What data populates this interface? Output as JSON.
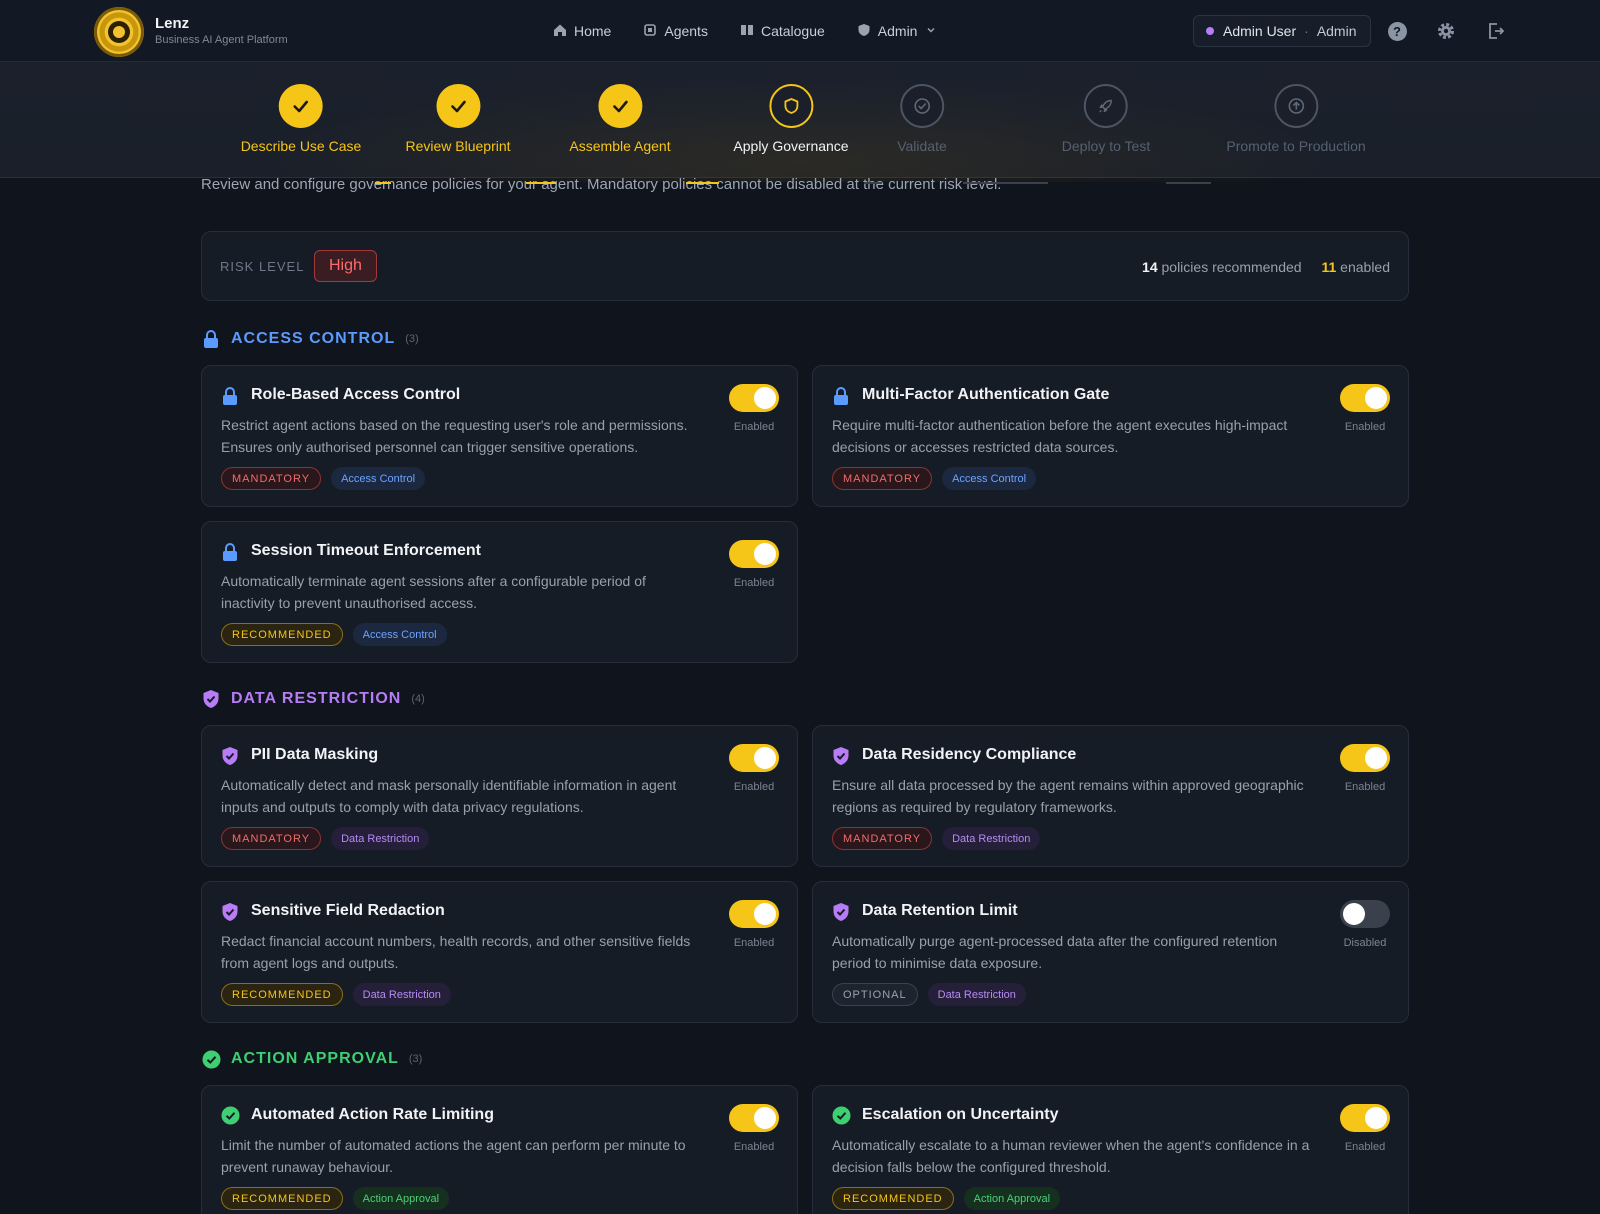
{
  "app": {
    "name": "Lenz",
    "tagline": "Business AI Agent Platform"
  },
  "nav": {
    "home": "Home",
    "agents": "Agents",
    "catalogue": "Catalogue",
    "admin": "Admin"
  },
  "user": {
    "name": "Admin User",
    "separator": "·",
    "role": "Admin"
  },
  "steps": [
    {
      "label": "Describe Use Case",
      "state": "done"
    },
    {
      "label": "Review Blueprint",
      "state": "done"
    },
    {
      "label": "Assemble Agent",
      "state": "done"
    },
    {
      "label": "Apply Governance",
      "state": "active"
    },
    {
      "label": "Validate",
      "state": "pending"
    },
    {
      "label": "Deploy to Test",
      "state": "pending"
    },
    {
      "label": "Promote to Production",
      "state": "pending"
    }
  ],
  "intro": "Review and configure governance policies for your agent. Mandatory policies cannot be disabled at the current risk level.",
  "risk": {
    "label": "RISK LEVEL",
    "level": "High",
    "recommended_count": "14",
    "recommended_text": "policies recommended",
    "enabled_count": "11",
    "enabled_text": "enabled"
  },
  "sections": {
    "access": {
      "title": "ACCESS CONTROL",
      "count": "(3)",
      "color": "#5b9bff"
    },
    "data": {
      "title": "DATA RESTRICTION",
      "count": "(4)",
      "color": "#b77cf6"
    },
    "action": {
      "title": "ACTION APPROVAL",
      "count": "(3)",
      "color": "#3ecf72"
    }
  },
  "policies": [
    {
      "title": "Role-Based Access Control",
      "desc": "Restrict agent actions based on the requesting user's role and permissions. Ensures only authorised personnel can trigger sensitive operations.",
      "level": "MANDATORY",
      "category": "Access Control",
      "state": "Enabled"
    },
    {
      "title": "Multi-Factor Authentication Gate",
      "desc": "Require multi-factor authentication before the agent executes high-impact decisions or accesses restricted data sources.",
      "level": "MANDATORY",
      "category": "Access Control",
      "state": "Enabled"
    },
    {
      "title": "Session Timeout Enforcement",
      "desc": "Automatically terminate agent sessions after a configurable period of inactivity to prevent unauthorised access.",
      "level": "RECOMMENDED",
      "category": "Access Control",
      "state": "Enabled"
    },
    {
      "title": "PII Data Masking",
      "desc": "Automatically detect and mask personally identifiable information in agent inputs and outputs to comply with data privacy regulations.",
      "level": "MANDATORY",
      "category": "Data Restriction",
      "state": "Enabled"
    },
    {
      "title": "Data Residency Compliance",
      "desc": "Ensure all data processed by the agent remains within approved geographic regions as required by regulatory frameworks.",
      "level": "MANDATORY",
      "category": "Data Restriction",
      "state": "Enabled"
    },
    {
      "title": "Sensitive Field Redaction",
      "desc": "Redact financial account numbers, health records, and other sensitive fields from agent logs and outputs.",
      "level": "RECOMMENDED",
      "category": "Data Restriction",
      "state": "Enabled"
    },
    {
      "title": "Data Retention Limit",
      "desc": "Automatically purge agent-processed data after the configured retention period to minimise data exposure.",
      "level": "OPTIONAL",
      "category": "Data Restriction",
      "state": "Disabled"
    },
    {
      "title": "Automated Action Rate Limiting",
      "desc": "Limit the number of automated actions the agent can perform per minute to prevent runaway behaviour.",
      "level": "RECOMMENDED",
      "category": "Action Approval",
      "state": "Enabled"
    },
    {
      "title": "Escalation on Uncertainty",
      "desc": "Automatically escalate to a human reviewer when the agent's confidence in a decision falls below the configured threshold.",
      "level": "RECOMMENDED",
      "category": "Action Approval",
      "state": "Enabled"
    }
  ],
  "colors": {
    "accent": "#f5c518",
    "mandatory": "#f26b6b",
    "access": "#5b9bff",
    "data": "#b77cf6",
    "action": "#3ecf72"
  }
}
